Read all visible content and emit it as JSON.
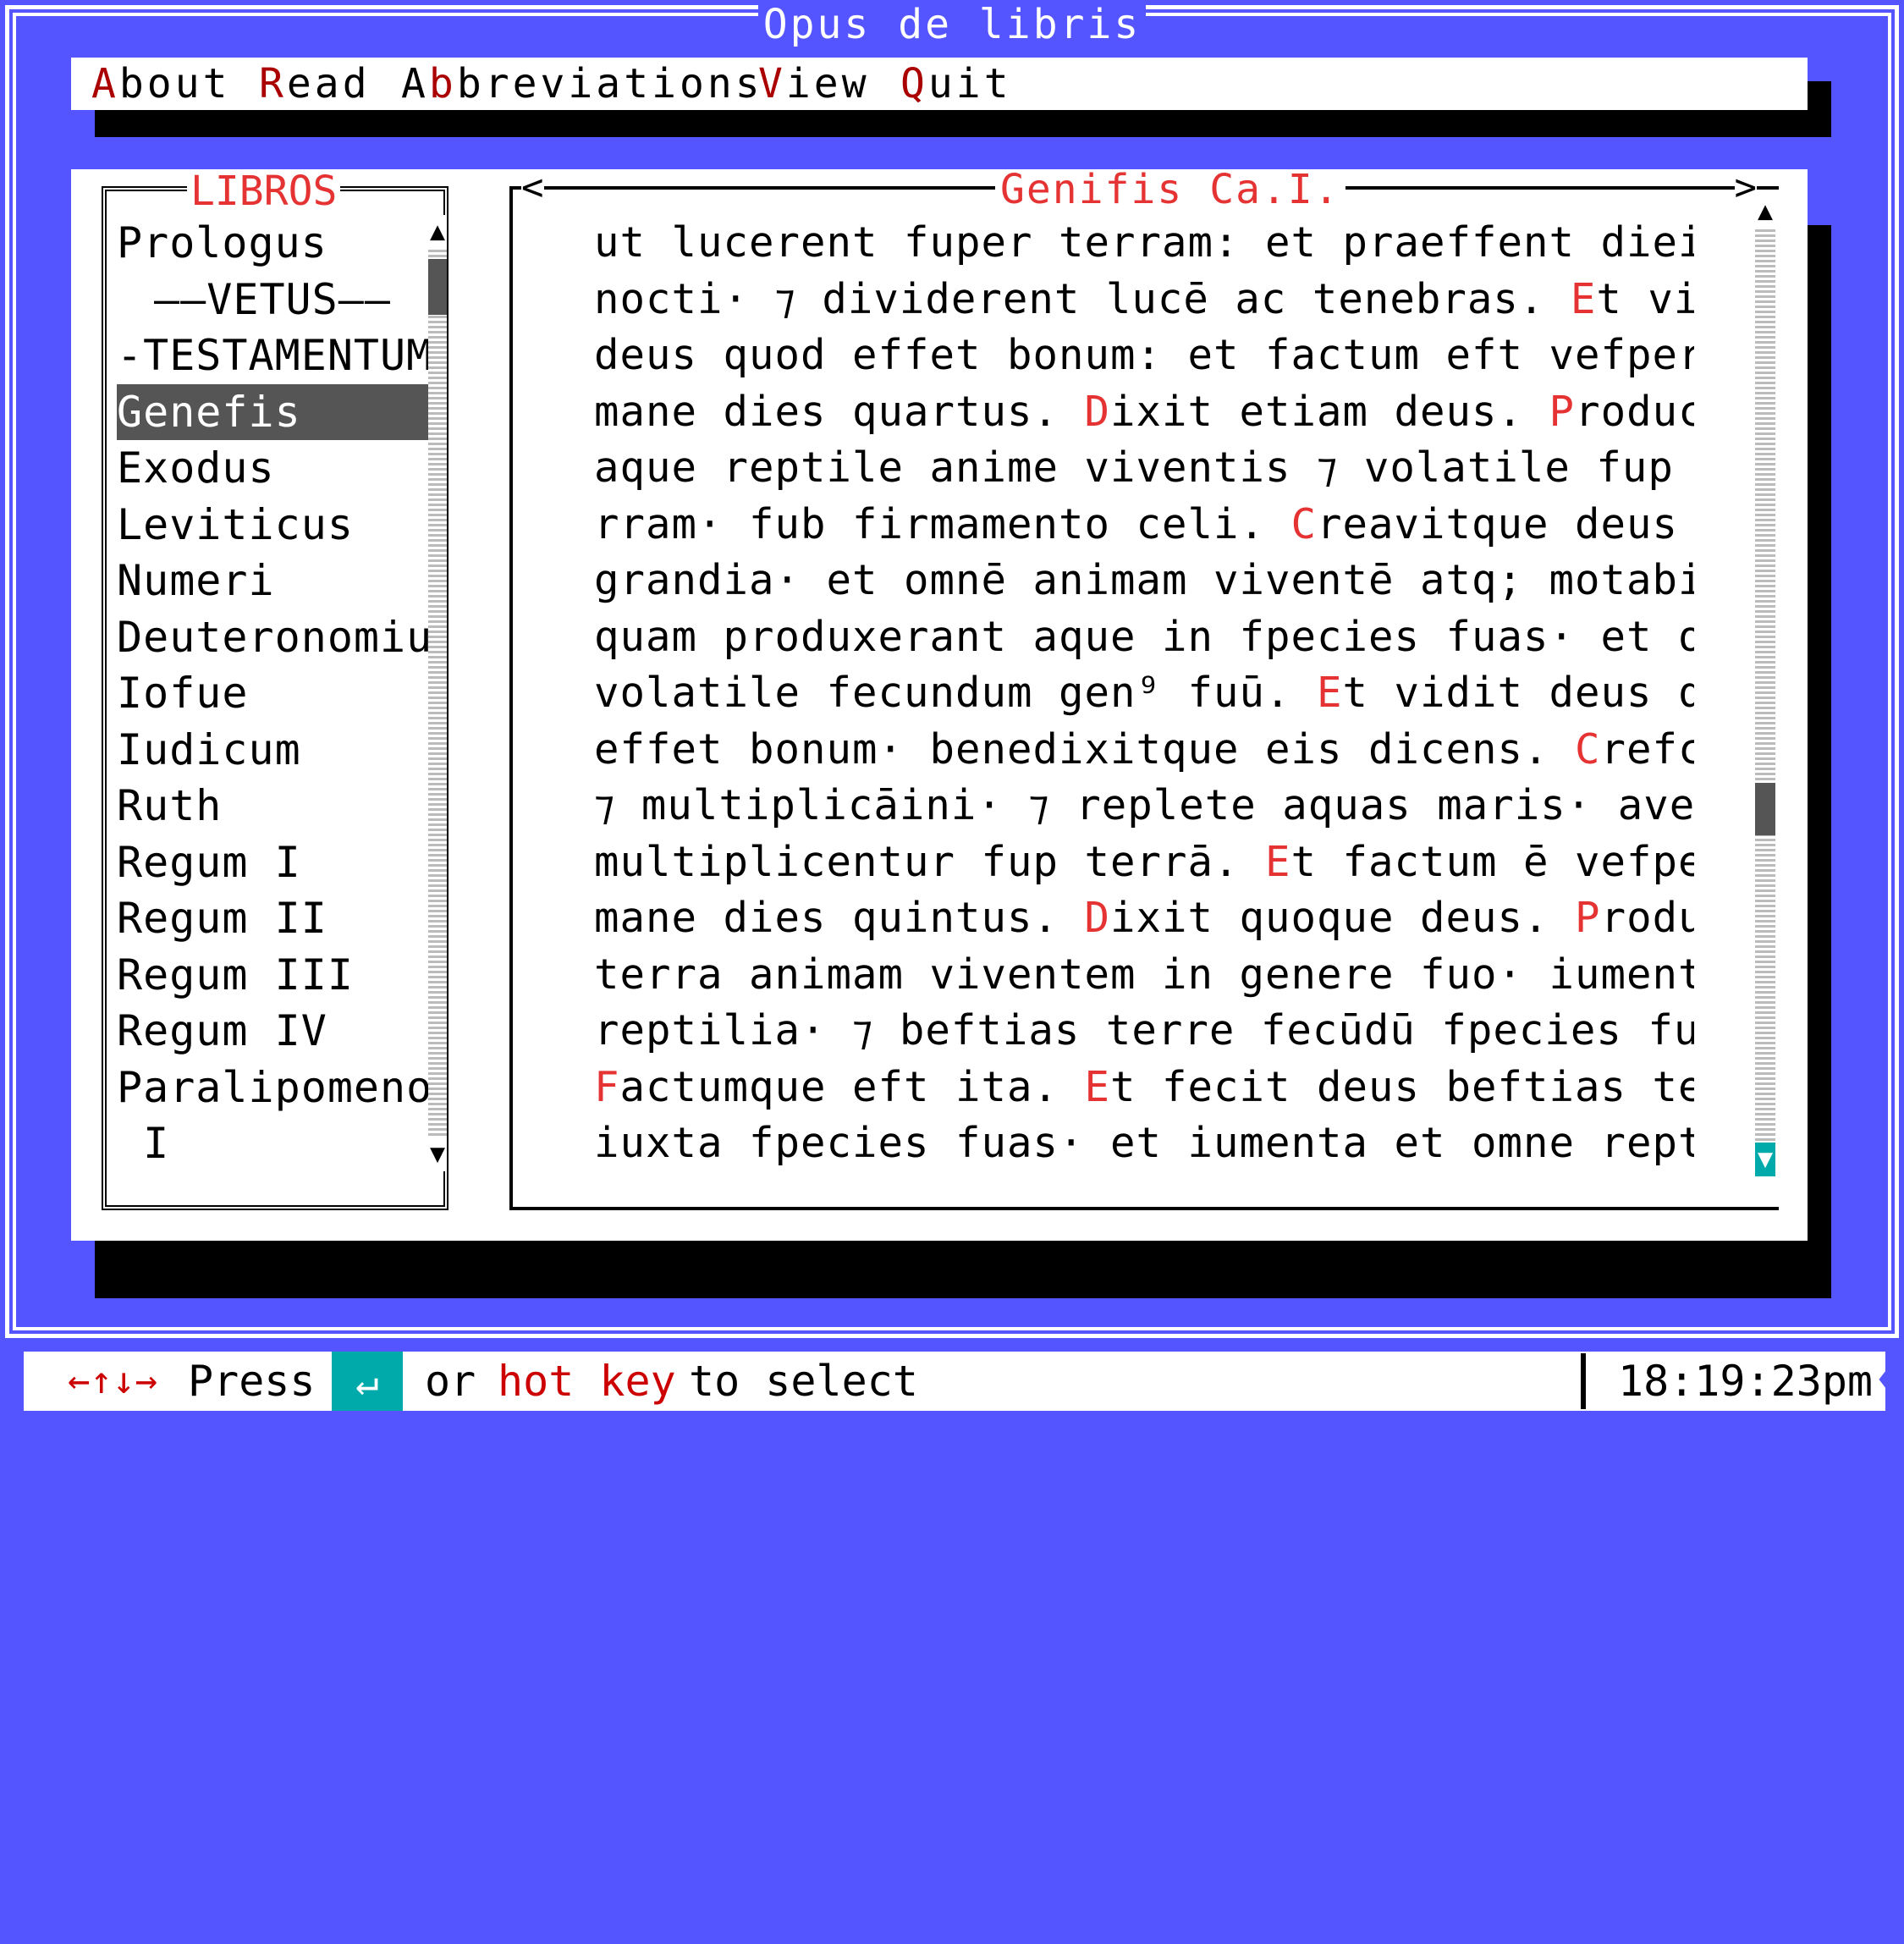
{
  "app": {
    "title": "Opus de libris"
  },
  "menu": [
    {
      "hotkey": "A",
      "rest": "bout"
    },
    {
      "hotkey": "R",
      "rest": "ead"
    },
    {
      "prefix": "A",
      "hotkey": "b",
      "rest": "breviations"
    },
    {
      "hotkey": "V",
      "rest": "iew"
    },
    {
      "hotkey": "Q",
      "rest": "uit"
    }
  ],
  "books": {
    "title": "LIBROS",
    "items": [
      "Prologus",
      "——VETUS——",
      "-TESTAMENTUM-",
      "Genefis",
      "Exodus",
      "Leviticus",
      "Numeri",
      "Deuteronomium",
      "Iofue",
      "Iudicum",
      "Ruth",
      "Regum I",
      "Regum II",
      "Regum III",
      "Regum IV",
      "Paralipomenon",
      " I"
    ],
    "selected_index": 3
  },
  "reader": {
    "title": "Genifis Ca.I.",
    "lines": [
      [
        "ut lucerent fuper terram: et praeffent diei ac"
      ],
      [
        "nocti· ⁊ dividerent lucē ac tenebras. ",
        {
          "hi": "E"
        },
        "t vidit"
      ],
      [
        "deus quod effet bonum: et factum eft vefpere ⁊"
      ],
      [
        "mane dies quartus. ",
        {
          "hi": "D"
        },
        "ixit etiam deus. ",
        {
          "hi": "P"
        },
        "roducant"
      ],
      [
        "aque reptile anime viventis ⁊ volatile fup te-"
      ],
      [
        "rram· fub firmamento celi. ",
        {
          "hi": "C"
        },
        "reavitque deus cete"
      ],
      [
        "grandia· et omnē animam viventē atq; motabilem"
      ],
      [
        "quam produxerant aque in fpecies fuas· et omne"
      ],
      [
        "volatile fecundum gen⁹ fuū. ",
        {
          "hi": "E"
        },
        "t vidit deus quod"
      ],
      [
        "effet bonum· benedixitque eis dicens. ",
        {
          "hi": "C"
        },
        "refcite"
      ],
      [
        "⁊ multiplicāini· ⁊ replete aquas maris· avefq;"
      ],
      [
        "multiplicentur fup terrā. ",
        {
          "hi": "E"
        },
        "t factum ē vefpe et"
      ],
      [
        "mane dies quintus. ",
        {
          "hi": "D"
        },
        "ixit quoque deus. ",
        {
          "hi": "P"
        },
        "roducat"
      ],
      [
        "terra animam viventem in genere fuo· iumenta ⁊"
      ],
      [
        "reptilia· ⁊ beftias terre fecūdū fpecies fuas."
      ],
      [
        {
          "hi": "F"
        },
        "actumque eft ita. ",
        {
          "hi": "E"
        },
        "t fecit deus beftias terre"
      ],
      [
        "iuxta fpecies fuas· et iumenta et omne reptile"
      ]
    ]
  },
  "status": {
    "arrows": "←↑↓→",
    "press": "Press",
    "enter_key": "↵",
    "or": "or",
    "hot_key": "hot key",
    "to_select": "to select",
    "clock": "18:19:23pm",
    "end_glyph": "♦"
  },
  "colors": {
    "background": "#5555ff",
    "hotkey": "#aa0000",
    "highlight": "#e53333",
    "selection": "#555555",
    "enter_key_bg": "#00aaaa"
  },
  "icons": {
    "scroll_up": "▲",
    "scroll_down": "▼",
    "nav_left": "<",
    "nav_right": ">"
  }
}
